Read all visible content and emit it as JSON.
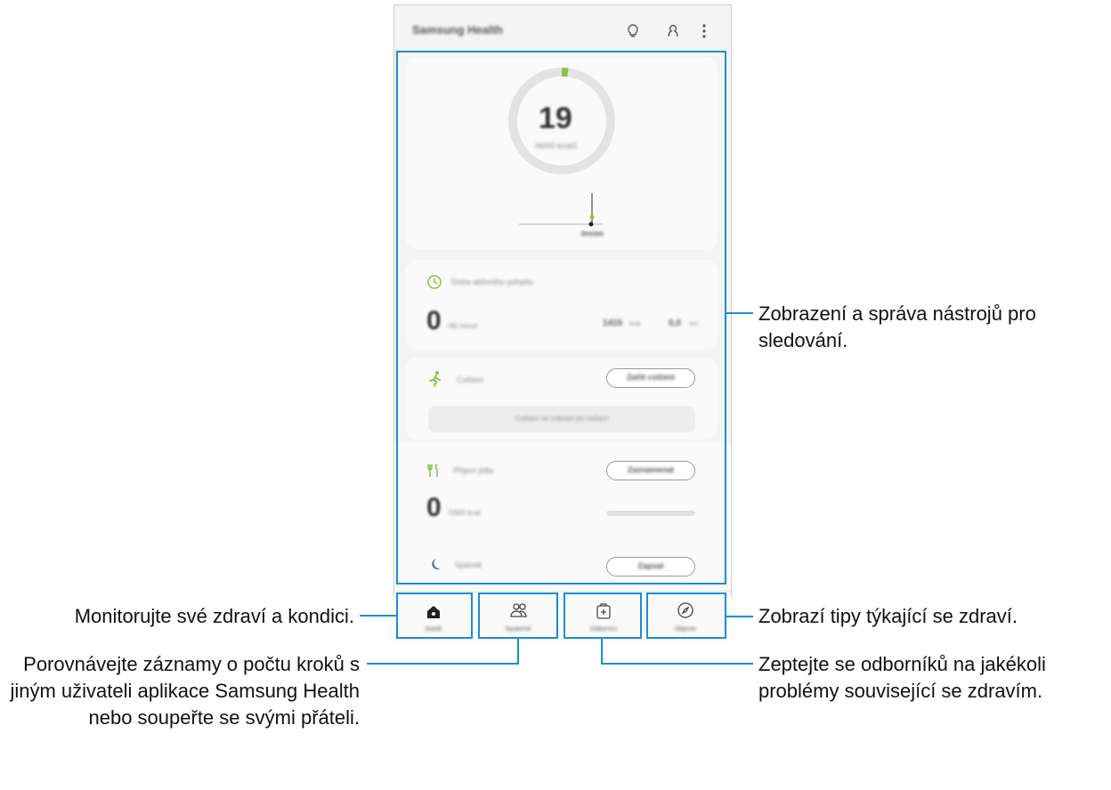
{
  "app": {
    "title": "Samsung Health",
    "bulb_icon": "lightbulb-icon",
    "profile_icon": "profile-icon",
    "menu_icon": "more-vert-icon"
  },
  "steps_card": {
    "value": "19",
    "target": "/6000 kroků",
    "progress_fraction": 0.02,
    "chart_labels": [
      "",
      "",
      "Dnešek"
    ]
  },
  "activity_card": {
    "title": "Doba aktivního pohybu",
    "value": "0",
    "unit": "/90 minut",
    "kcal_value": "1415",
    "kcal_unit": "kcal",
    "dist_value": "0,0",
    "dist_unit": "km"
  },
  "exercise_card": {
    "title": "Cvičení",
    "button": "Začít cvičení",
    "hint": "Cvičení se zobrazí po cvičení"
  },
  "food_card": {
    "title": "Příjem jídla",
    "button": "Zaznamenat",
    "value": "0",
    "unit": "/1800 kcal"
  },
  "sleep_card": {
    "title": "Spánek",
    "button": "Zapsat"
  },
  "nav": {
    "home": "Domů",
    "together": "Společně",
    "experts": "Odborníci",
    "discover": "Objevte"
  },
  "callouts": {
    "tools": "Zobrazení a správa nástrojů pro sledování.",
    "monitor": "Monitorujte své zdraví a kondici.",
    "tips": "Zobrazí tipy týkající se zdraví.",
    "compare": "Porovnávejte záznamy o počtu kroků s jiným uživateli aplikace Samsung Health nebo soupeřte se svými přáteli.",
    "experts": "Zeptejte se odborníků na jakékoli problémy související se zdravím."
  },
  "colors": {
    "accent": "#1a8fd1",
    "green": "#8bc34a"
  }
}
